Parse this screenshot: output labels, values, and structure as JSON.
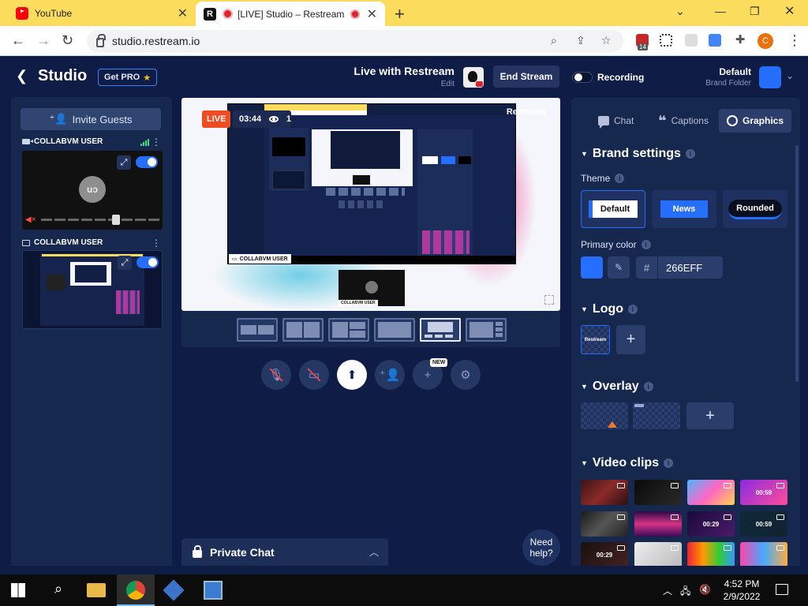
{
  "browser": {
    "tabs": [
      {
        "title": "YouTube"
      },
      {
        "title": "[LIVE] Studio – Restream"
      }
    ],
    "url": "studio.restream.io",
    "extension_badge": "14",
    "profile_initial": "C"
  },
  "header": {
    "back_label": "<",
    "title": "Studio",
    "get_pro": "Get PRO",
    "stream_title": "Live with Restream",
    "edit_label": "Edit",
    "end_stream": "End Stream",
    "recording_label": "Recording",
    "brand_name": "Default",
    "brand_folder": "Brand Folder",
    "brand_color": "#266eff"
  },
  "sources": {
    "invite": "Invite Guests",
    "items": [
      {
        "label": "COLLABVM USER",
        "type": "camera",
        "avatar": "uɔ"
      },
      {
        "label": "COLLABVM USER",
        "type": "screen"
      }
    ]
  },
  "stage": {
    "live_badge": "LIVE",
    "timer": "03:44",
    "viewers": "1",
    "name_tag": "COLLABVM USER",
    "cam_name_tag": "COLLABVM USER",
    "watermark": "Restream",
    "layouts": [
      "layout-1",
      "layout-2",
      "layout-3",
      "layout-4",
      "layout-5",
      "layout-6"
    ],
    "selected_layout": 4,
    "new_badge": "NEW"
  },
  "private_chat": {
    "label": "Private Chat"
  },
  "need_help": "Need help?",
  "right_panel": {
    "tabs": [
      {
        "label": "Chat",
        "icon": "chat-icon"
      },
      {
        "label": "Captions",
        "icon": "captions-icon"
      },
      {
        "label": "Graphics",
        "icon": "palette-icon"
      }
    ],
    "active_tab": "Graphics",
    "brand_settings": "Brand settings",
    "theme_label": "Theme",
    "themes": [
      "Default",
      "News",
      "Rounded"
    ],
    "selected_theme": "Default",
    "primary_color_label": "Primary color",
    "primary_color_hash": "#",
    "primary_color_hex": "266EFF",
    "logo_label": "Logo",
    "logo_thumb": "Restream",
    "overlay_label": "Overlay",
    "video_clips_label": "Video clips",
    "clips": [
      {
        "duration": ""
      },
      {
        "duration": ""
      },
      {
        "duration": ""
      },
      {
        "duration": "00:59"
      },
      {
        "duration": ""
      },
      {
        "duration": ""
      },
      {
        "duration": "00:29"
      },
      {
        "duration": "00:59"
      },
      {
        "duration": "00:29"
      },
      {
        "duration": ""
      },
      {
        "duration": ""
      },
      {
        "duration": ""
      }
    ]
  },
  "taskbar": {
    "time": "4:52 PM",
    "date": "2/9/2022"
  }
}
